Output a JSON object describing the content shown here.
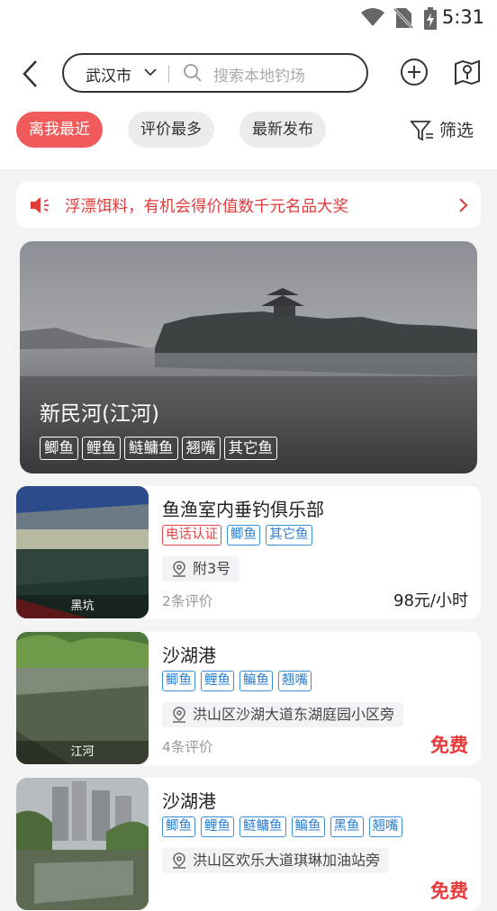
{
  "status": {
    "time": "5:31"
  },
  "header": {
    "city": "武汉市",
    "search_placeholder": "搜索本地钓场"
  },
  "filters": {
    "chips": [
      "离我最近",
      "评价最多",
      "最新发布"
    ],
    "active_index": 0,
    "filter_label": "筛选"
  },
  "notice": {
    "text": "浮漂饵料，有机会得价值数千元名品大奖"
  },
  "hero": {
    "name": "新民河(江河)",
    "tags": [
      "鲫鱼",
      "鲤鱼",
      "鲢鳙鱼",
      "翘嘴",
      "其它鱼"
    ]
  },
  "spots": [
    {
      "title": "鱼渔室内垂钓俱乐部",
      "type_label": "黑坑",
      "badge": "电话认证",
      "tags": [
        "鲫鱼",
        "其它鱼"
      ],
      "address": "附3号",
      "reviews": "2条评价",
      "price": "98元/小时",
      "free": false
    },
    {
      "title": "沙湖港",
      "type_label": "江河",
      "badge": "",
      "tags": [
        "鲫鱼",
        "鲤鱼",
        "鳊鱼",
        "翘嘴"
      ],
      "address": "洪山区沙湖大道东湖庭园小区旁",
      "reviews": "4条评价",
      "price": "免费",
      "free": true
    },
    {
      "title": "沙湖港",
      "type_label": "",
      "badge": "",
      "tags": [
        "鲫鱼",
        "鲤鱼",
        "鲢鳙鱼",
        "鳊鱼",
        "黑鱼",
        "翘嘴"
      ],
      "address": "洪山区欢乐大道琪琳加油站旁",
      "reviews": "",
      "price": "免费",
      "free": true
    }
  ],
  "colors": {
    "accent": "#f15a5a",
    "tag_blue": "#2a7fd0",
    "free_red": "#e83a3a"
  }
}
